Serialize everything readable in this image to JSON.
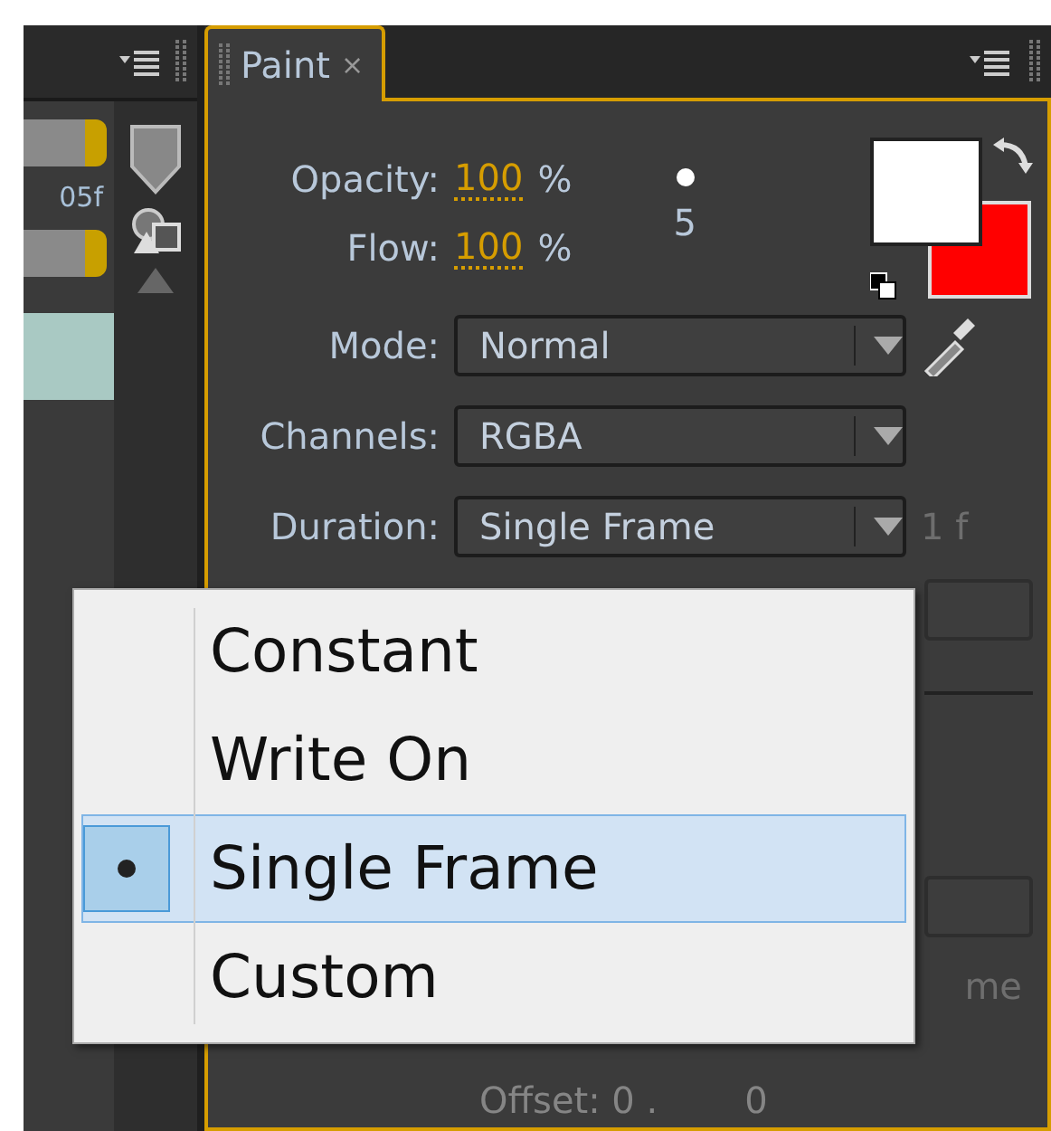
{
  "left_panel": {
    "timecode": "05f"
  },
  "paint_panel": {
    "tab": {
      "label": "Paint",
      "close": "×",
      "selected": true
    },
    "opacity": {
      "label": "Opacity:",
      "value": "100",
      "unit": "%"
    },
    "flow": {
      "label": "Flow:",
      "value": "100",
      "unit": "%"
    },
    "brush_size": "5",
    "mode": {
      "label": "Mode:",
      "value": "Normal"
    },
    "channels": {
      "label": "Channels:",
      "value": "RGBA"
    },
    "duration": {
      "label": "Duration:",
      "value": "Single Frame",
      "frames": "1",
      "frames_unit": "f"
    },
    "cut_text": "me",
    "offset": {
      "label": "Offset: 0 .",
      "value": "0"
    }
  },
  "duration_menu": [
    {
      "label": "Constant",
      "selected": false
    },
    {
      "label": "Write On",
      "selected": false
    },
    {
      "label": "Single Frame",
      "selected": true
    },
    {
      "label": "Custom",
      "selected": false
    }
  ]
}
